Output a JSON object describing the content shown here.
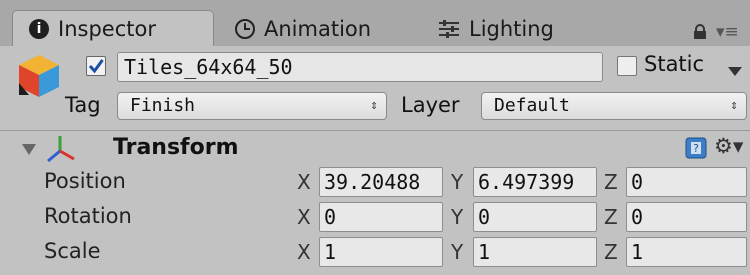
{
  "tabs": [
    {
      "label": "Inspector",
      "icon": "info-icon",
      "active": true
    },
    {
      "label": "Animation",
      "icon": "clock-icon",
      "active": false
    },
    {
      "label": "Lighting",
      "icon": "lighting-sliders-icon",
      "active": false
    }
  ],
  "inspector_tab_glyph": "i",
  "object": {
    "active": true,
    "name": "Tiles_64x64_50",
    "static_label": "Static",
    "static": false,
    "tag_label": "Tag",
    "tag_value": "Finish",
    "layer_label": "Layer",
    "layer_value": "Default"
  },
  "transform": {
    "title": "Transform",
    "rows": [
      {
        "label": "Position",
        "x": "39.20488",
        "y": "6.497399",
        "z": "0"
      },
      {
        "label": "Rotation",
        "x": "0",
        "y": "0",
        "z": "0"
      },
      {
        "label": "Scale",
        "x": "1",
        "y": "1",
        "z": "1"
      }
    ]
  },
  "axis_labels": {
    "x": "X",
    "y": "Y",
    "z": "Z"
  },
  "popup_arrows": "⇕",
  "colors": {
    "panel_bg": "#c2c2c2",
    "tabbar_bg": "#a8a8a8",
    "check_blue": "#1c4fa3"
  }
}
